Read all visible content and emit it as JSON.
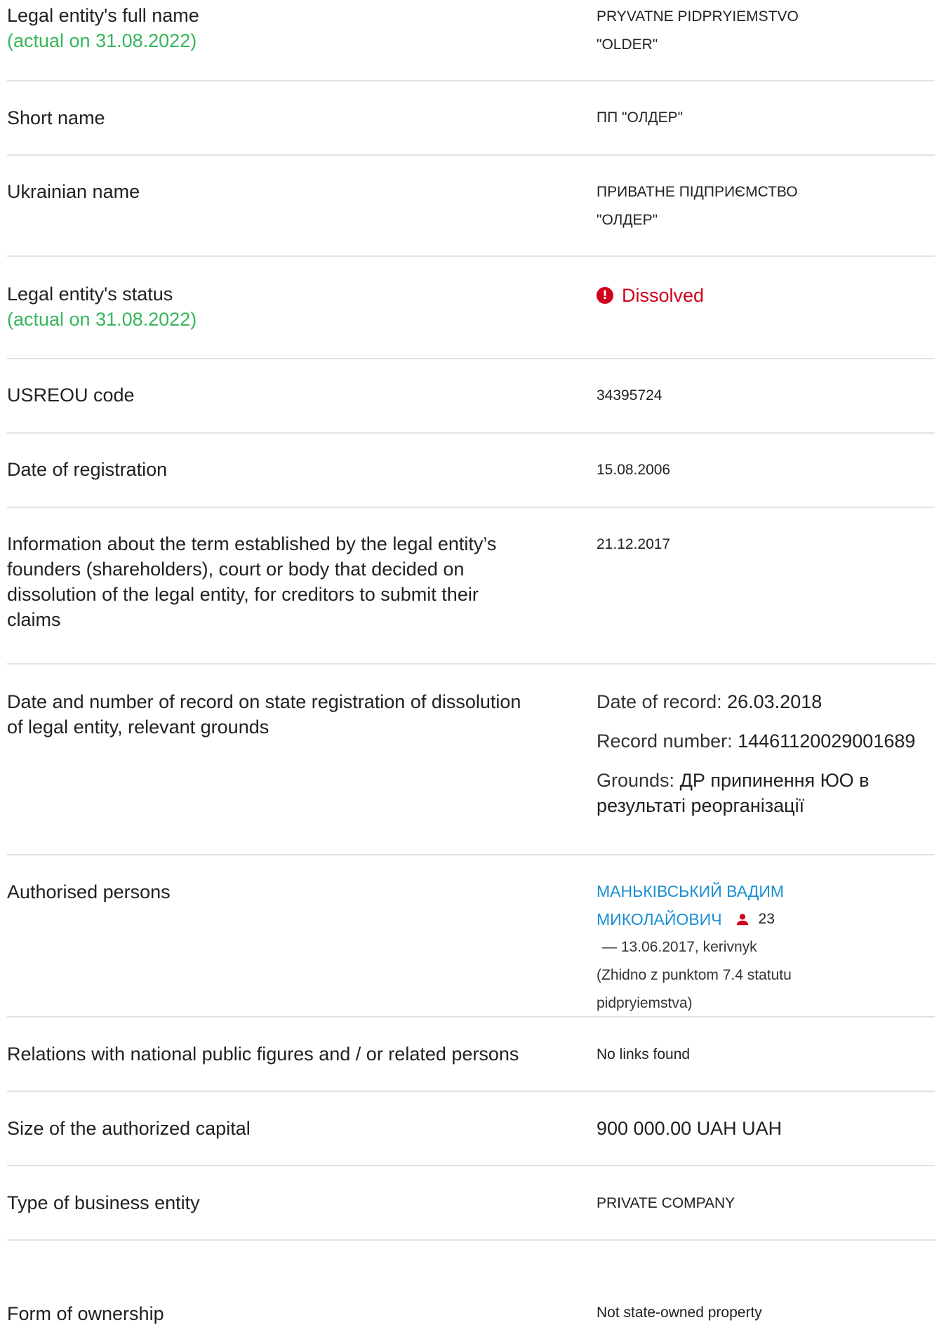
{
  "rows": {
    "full_name": {
      "label": "Legal entity's full name",
      "sub": "(actual on 31.08.2022)",
      "value_line1": "PRYVATNE PIDPRYIEMSTVO",
      "value_line2": "\"OLDER\""
    },
    "short_name": {
      "label": "Short name",
      "value": "ПП \"ОЛДЕР\""
    },
    "ukrainian_name": {
      "label": "Ukrainian name",
      "value_line1": "ПРИВАТНЕ ПІДПРИЄМСТВО",
      "value_line2": "\"ОЛДЕР\""
    },
    "status": {
      "label": "Legal entity's status",
      "sub": "(actual on 31.08.2022)",
      "value": "Dissolved",
      "icon": "exclamation-circle-icon",
      "color": "#d0021b"
    },
    "usreou": {
      "label": "USREOU code",
      "value": "34395724"
    },
    "registration_date": {
      "label": "Date of registration",
      "value": "15.08.2006"
    },
    "creditors_term": {
      "label_lines": [
        "Information about the term established by the legal entity’s",
        "founders (shareholders), court or body that decided on",
        "dissolution of the legal entity, for creditors to submit their",
        "claims"
      ],
      "value": "21.12.2017"
    },
    "dissolution_record": {
      "label_lines": [
        "Date and number of record on state registration of dissolution",
        "of legal entity, relevant grounds"
      ],
      "date_key": "Date of record:",
      "date_value": "26.03.2018",
      "number_key": "Record number:",
      "number_value": "14461120029001689",
      "grounds_key": "Grounds:",
      "grounds_value_line1": "ДР припинення ЮО в",
      "grounds_value_line2": "результаті реорганізації"
    },
    "authorised_persons": {
      "label": "Authorised persons",
      "name_line1": "МАНЬКІВСЬКИЙ ВАДИМ",
      "name_line2": "МИКОЛАЙОВИЧ",
      "icon": "person-icon",
      "count": "23",
      "meta_line1": "— 13.06.2017, kerivnyk",
      "meta_line2": "(Zhidno z punktom 7.4 statutu",
      "meta_line3": "pidpryiemstva)"
    },
    "relations": {
      "label": "Relations with national public figures and / or related persons",
      "value": "No links found"
    },
    "capital": {
      "label": "Size of the authorized capital",
      "value": "900 000.00 UAH UAH"
    },
    "business_type": {
      "label": "Type of business entity",
      "value": "PRIVATE COMPANY"
    },
    "ownership": {
      "label": "Form of ownership",
      "value": "Not state-owned property"
    }
  },
  "colors": {
    "accent_green": "#35b65a",
    "link_blue": "#1a8fd3",
    "status_red": "#d0021b",
    "separator": "#e2e2e2"
  }
}
